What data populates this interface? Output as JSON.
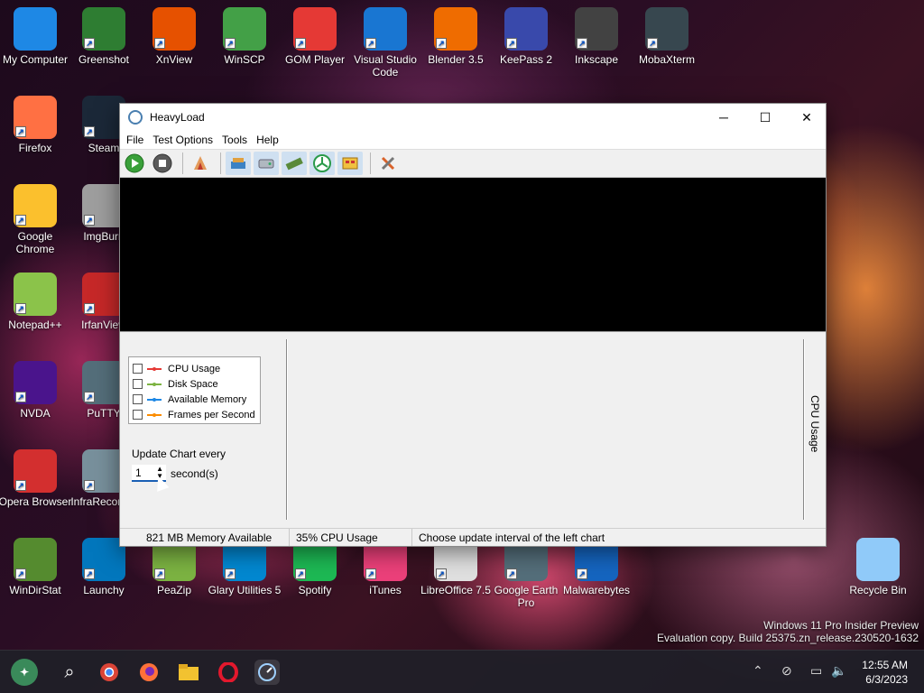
{
  "desktop": {
    "icons": [
      {
        "label": "My Computer",
        "icon": "monitor-icon",
        "color": "#1e88e5"
      },
      {
        "label": "Greenshot",
        "icon": "greenshot-icon",
        "color": "#2e7d32"
      },
      {
        "label": "XnView",
        "icon": "xnview-icon",
        "color": "#e65100"
      },
      {
        "label": "WinSCP",
        "icon": "winscp-icon",
        "color": "#43a047"
      },
      {
        "label": "GOM Player",
        "icon": "gom-player-icon",
        "color": "#e53935"
      },
      {
        "label": "Visual Studio Code",
        "icon": "vscode-icon",
        "color": "#1976d2"
      },
      {
        "label": "Blender 3.5",
        "icon": "blender-icon",
        "color": "#ef6c00"
      },
      {
        "label": "KeePass 2",
        "icon": "keepass-icon",
        "color": "#3949ab"
      },
      {
        "label": "Inkscape",
        "icon": "inkscape-icon",
        "color": "#424242"
      },
      {
        "label": "MobaXterm",
        "icon": "mobaxterm-icon",
        "color": "#37474f"
      },
      {
        "label": "Firefox",
        "icon": "firefox-icon",
        "color": "#ff7043"
      },
      {
        "label": "Steam",
        "icon": "steam-icon",
        "color": "#1b2838"
      },
      {
        "label": "Google Chrome",
        "icon": "chrome-icon",
        "color": "#fbc02d"
      },
      {
        "label": "ImgBurn",
        "icon": "imgburn-icon",
        "color": "#9e9e9e"
      },
      {
        "label": "Notepad++",
        "icon": "notepadpp-icon",
        "color": "#8bc34a"
      },
      {
        "label": "IrfanView",
        "icon": "irfanview-icon",
        "color": "#c62828"
      },
      {
        "label": "NVDA",
        "icon": "nvda-icon",
        "color": "#4a148c"
      },
      {
        "label": "PuTTY",
        "icon": "putty-icon",
        "color": "#546e7a"
      },
      {
        "label": "Opera Browser",
        "icon": "opera-icon",
        "color": "#d32f2f"
      },
      {
        "label": "InfraRecorder",
        "icon": "infrarecorder-icon",
        "color": "#78909c"
      },
      {
        "label": "WinDirStat",
        "icon": "windirstat-icon",
        "color": "#558b2f"
      },
      {
        "label": "Launchy",
        "icon": "launchy-icon",
        "color": "#0277bd"
      },
      {
        "label": "PeaZip",
        "icon": "peazip-icon",
        "color": "#7cb342"
      },
      {
        "label": "Glary Utilities 5",
        "icon": "glary-icon",
        "color": "#0288d1"
      },
      {
        "label": "Spotify",
        "icon": "spotify-icon",
        "color": "#1db954"
      },
      {
        "label": "iTunes",
        "icon": "itunes-icon",
        "color": "#ec407a"
      },
      {
        "label": "LibreOffice 7.5",
        "icon": "libreoffice-icon",
        "color": "#e0e0e0"
      },
      {
        "label": "Google Earth Pro",
        "icon": "google-earth-icon",
        "color": "#546e7a"
      },
      {
        "label": "Malwarebytes",
        "icon": "malwarebytes-icon",
        "color": "#1565c0"
      },
      {
        "label": "Recycle Bin",
        "icon": "recycle-bin-icon",
        "color": "#90caf9"
      }
    ]
  },
  "window": {
    "title": "HeavyLoad",
    "controls": {
      "minimize": "─",
      "maximize": "☐",
      "close": "✕"
    },
    "menu": [
      "File",
      "Test Options",
      "Tools",
      "Help"
    ],
    "legend": [
      {
        "label": "CPU Usage",
        "color": "#e53935"
      },
      {
        "label": "Disk Space",
        "color": "#7cb342"
      },
      {
        "label": "Available Memory",
        "color": "#1e88e5"
      },
      {
        "label": "Frames per Second",
        "color": "#fb8c00"
      }
    ],
    "update_label": "Update Chart every",
    "update_value": "1",
    "seconds_label": "second(s)",
    "right_chart_label": "CPU Usage",
    "status": {
      "memory": "821 MB Memory Available",
      "cpu": "35% CPU Usage",
      "hint": "Choose update interval of the left chart"
    }
  },
  "watermark": {
    "line1": "Windows 11 Pro Insider Preview",
    "line2": "Evaluation copy. Build 25375.zn_release.230520-1632"
  },
  "taskbar": {
    "time": "12:55 AM",
    "date": "6/3/2023"
  }
}
